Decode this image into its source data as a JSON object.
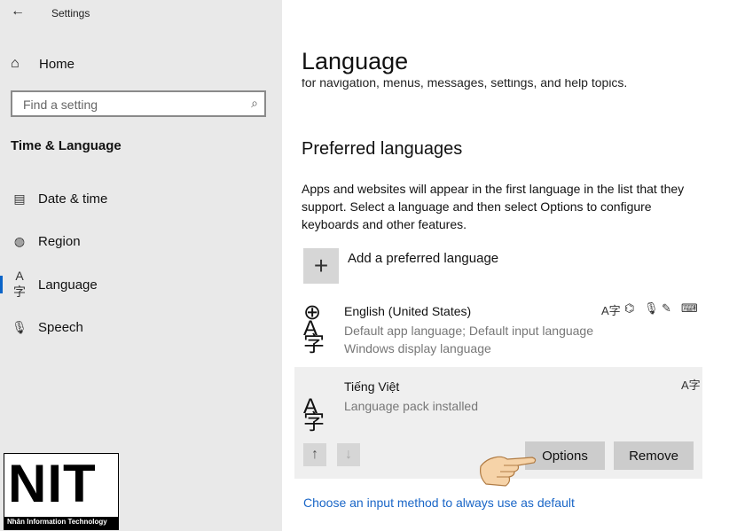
{
  "window": {
    "title": "Settings",
    "back_icon": "back-arrow-icon"
  },
  "sidebar": {
    "home_label": "Home",
    "search": {
      "placeholder": "Find a setting"
    },
    "section_title": "Time & Language",
    "items": [
      {
        "label": "Date & time",
        "icon": "calendar-clock-icon"
      },
      {
        "label": "Region",
        "icon": "globe-region-icon"
      },
      {
        "label": "Language",
        "icon": "language-icon",
        "active": true
      },
      {
        "label": "Speech",
        "icon": "microphone-icon"
      }
    ]
  },
  "main": {
    "title": "Language",
    "cut_text": "for navigation, menus, messages, settings, and help topics.",
    "preferred_heading": "Preferred languages",
    "description": "Apps and websites will appear in the first language in the list that they support. Select a language and then select Options to configure keyboards and other features.",
    "add_label": "Add a preferred language",
    "languages": [
      {
        "name": "English (United States)",
        "line1": "Default app language; Default input language",
        "line2": "Windows display language"
      },
      {
        "name": "Tiếng Việt",
        "line1": "Language pack installed"
      }
    ],
    "options_label": "Options",
    "remove_label": "Remove",
    "link": "Choose an input method to always use as default"
  },
  "watermark": {
    "main": "NIT",
    "sub": "Nhân Information Technology"
  },
  "colors": {
    "accent": "#0a64c8",
    "link": "#1a66c7",
    "sidebar_bg": "#e9e9e9"
  }
}
